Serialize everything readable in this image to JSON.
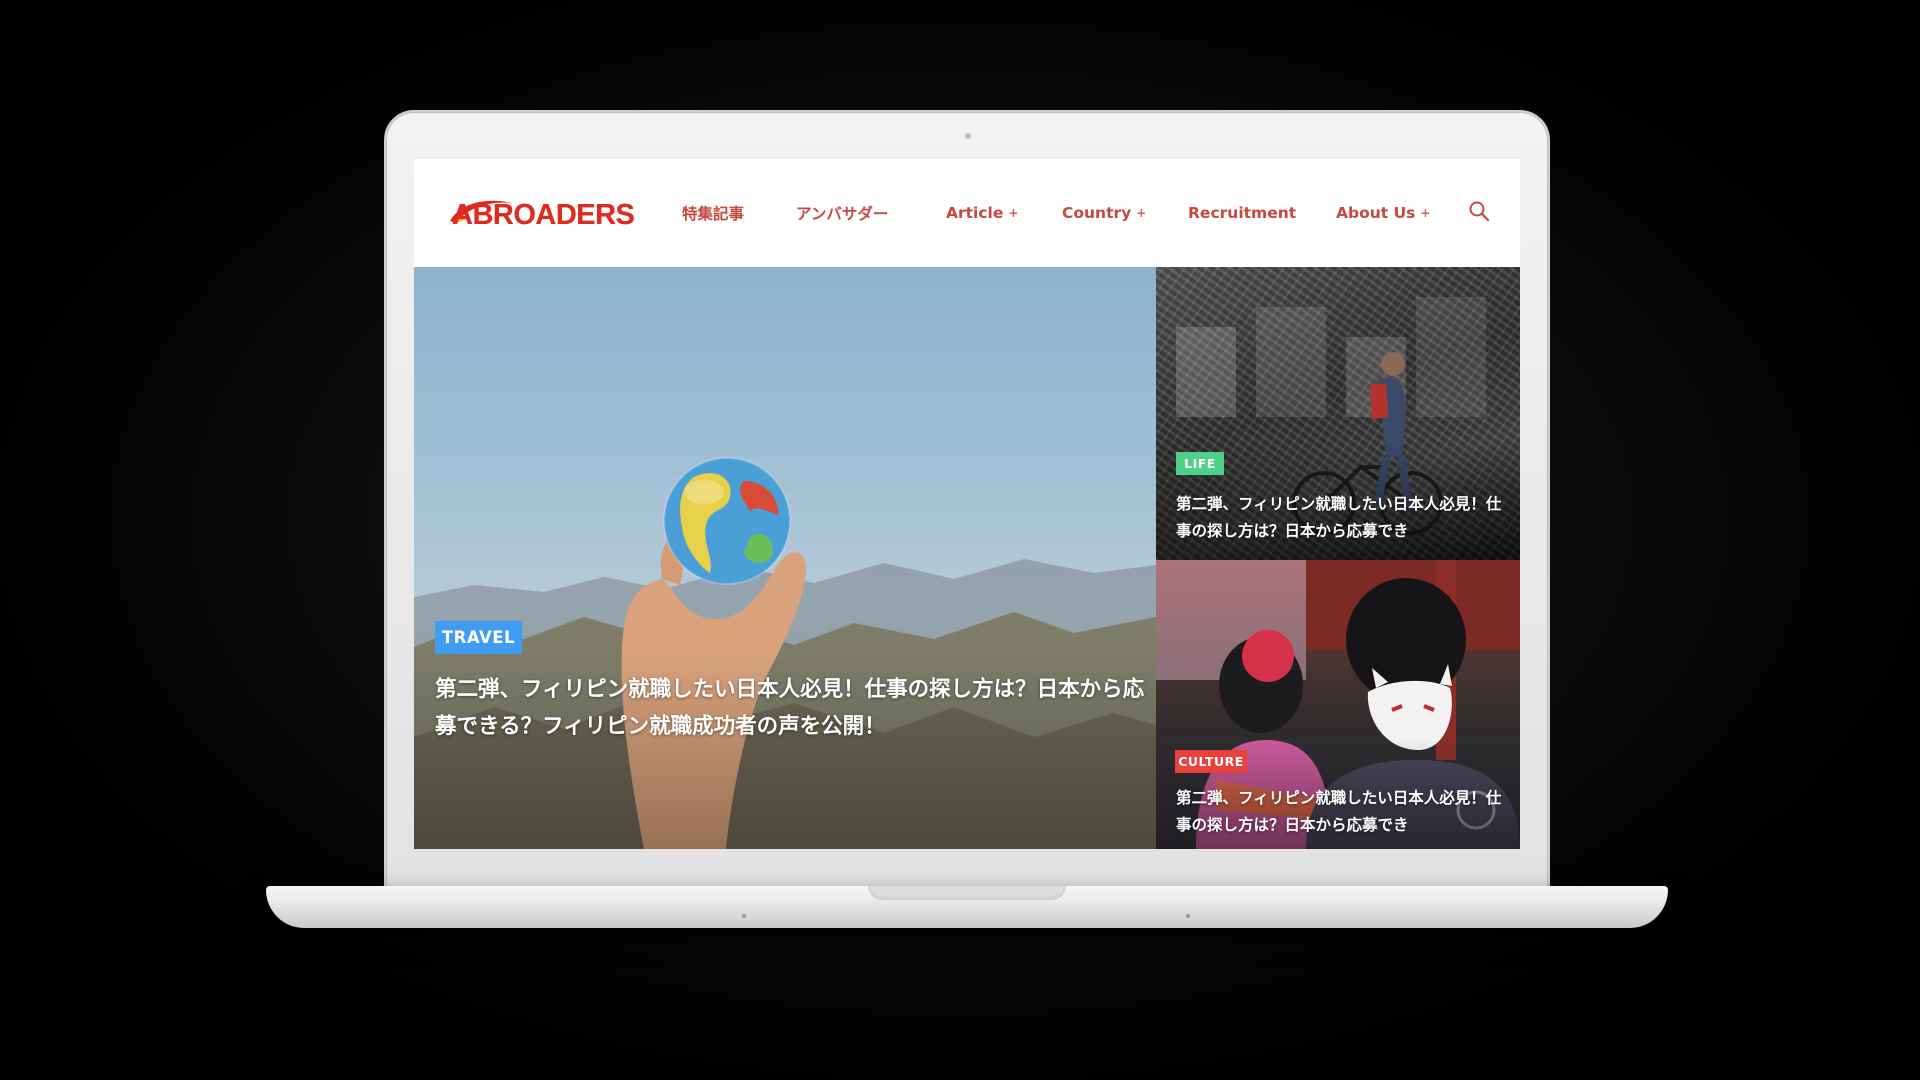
{
  "site": {
    "logo_text": "ABROADERS",
    "brand_color": "#e02a1f"
  },
  "nav": {
    "items": [
      {
        "label": "特集記事",
        "has_submenu": false
      },
      {
        "label": "アンバサダー",
        "has_submenu": false
      },
      {
        "label": "Article",
        "has_submenu": true
      },
      {
        "label": "Country",
        "has_submenu": true
      },
      {
        "label": "Recruitment",
        "has_submenu": false
      },
      {
        "label": "About Us",
        "has_submenu": true
      }
    ],
    "submenu_marker": "+",
    "search_icon": "search-icon",
    "text_color": "#c7483d"
  },
  "hero": {
    "main": {
      "category": "TRAVEL",
      "category_color": "#3f9cf0",
      "title": "第二弾、フィリピン就職したい日本人必見！仕事の探し方は？日本から応募できる？フィリピン就職成功者の声を公開！"
    },
    "side_top": {
      "category": "LIFE",
      "category_color": "#4fd08a",
      "title": "第二弾、フィリピン就職したい日本人必見！仕事の探し方は？日本から応募でき"
    },
    "side_bottom": {
      "category": "CULTURE",
      "category_color": "#e8423a",
      "title": "第二弾、フィリピン就職したい日本人必見！仕事の探し方は？日本から応募でき"
    }
  }
}
